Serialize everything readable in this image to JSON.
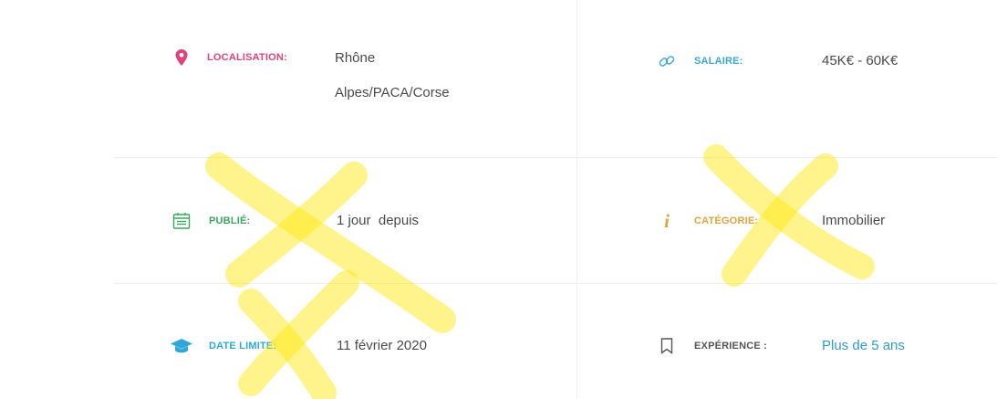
{
  "fields": {
    "location": {
      "label": "LOCALISATION:",
      "value": "Rhône Alpes/PACA/Corse",
      "color": "#e0427d",
      "icon": "map-pin-icon"
    },
    "salary": {
      "label": "SALAIRE:",
      "value": "45K€ - 60K€",
      "color": "#3aa6d8",
      "icon": "link-icon"
    },
    "published": {
      "label": "PUBLIÉ:",
      "value": "1 jour  depuis",
      "color": "#3aa65e",
      "icon": "calendar-icon"
    },
    "category": {
      "label": "CATÉGORIE:",
      "value": "Immobilier",
      "color": "#e0a43a",
      "icon": "info-icon"
    },
    "deadline": {
      "label": "DATE LIMITE:",
      "value": "11 février 2020",
      "color": "#2fa7d8",
      "icon": "graduation-cap-icon"
    },
    "experience": {
      "label": "EXPÉRIENCE :",
      "value": "Plus de 5 ans",
      "color": "#555555",
      "value_color": "#2f9bd6",
      "icon": "bookmark-icon"
    }
  },
  "colors": {
    "divider": "#eeeeee",
    "highlighter": "#ffe600"
  }
}
